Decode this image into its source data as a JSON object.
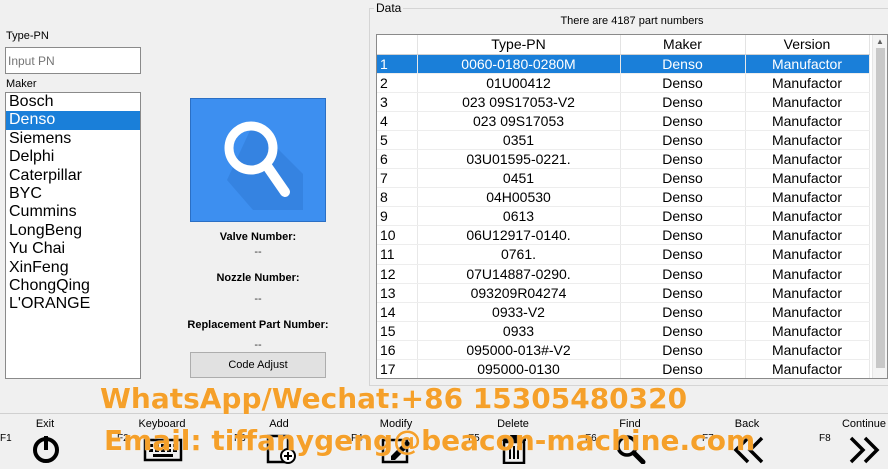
{
  "left": {
    "type_pn_label": "Type-PN",
    "input_placeholder": "Input PN",
    "maker_label": "Maker",
    "makers": [
      "Bosch",
      "Denso",
      "Siemens",
      "Delphi",
      "Caterpillar",
      "BYC",
      "Cummins",
      "LongBeng",
      "Yu Chai",
      "XinFeng",
      "ChongQing",
      "L'ORANGE"
    ],
    "selected_maker": "Denso"
  },
  "info": {
    "valve_label": "Valve Number:",
    "valve_value": "--",
    "nozzle_label": "Nozzle Number:",
    "nozzle_value": "--",
    "replacement_label": "Replacement Part Number:",
    "replacement_value": "--",
    "code_adjust": "Code Adjust"
  },
  "data": {
    "title": "Data",
    "count_text": "There are 4187 part numbers",
    "columns": [
      "",
      "Type-PN",
      "Maker",
      "Version"
    ],
    "rows": [
      [
        "1",
        "0060-0180-0280M",
        "Denso",
        "Manufactor"
      ],
      [
        "2",
        "01U00412",
        "Denso",
        "Manufactor"
      ],
      [
        "3",
        "023 09S17053-V2",
        "Denso",
        "Manufactor"
      ],
      [
        "4",
        "023 09S17053",
        "Denso",
        "Manufactor"
      ],
      [
        "5",
        "0351",
        "Denso",
        "Manufactor"
      ],
      [
        "6",
        "03U01595-0221.",
        "Denso",
        "Manufactor"
      ],
      [
        "7",
        "0451",
        "Denso",
        "Manufactor"
      ],
      [
        "8",
        "04H00530",
        "Denso",
        "Manufactor"
      ],
      [
        "9",
        "0613",
        "Denso",
        "Manufactor"
      ],
      [
        "10",
        "06U12917-0140.",
        "Denso",
        "Manufactor"
      ],
      [
        "11",
        "0761.",
        "Denso",
        "Manufactor"
      ],
      [
        "12",
        "07U14887-0290.",
        "Denso",
        "Manufactor"
      ],
      [
        "13",
        "093209R04274",
        "Denso",
        "Manufactor"
      ],
      [
        "14",
        "0933-V2",
        "Denso",
        "Manufactor"
      ],
      [
        "15",
        "0933",
        "Denso",
        "Manufactor"
      ],
      [
        "16",
        "095000-013#-V2",
        "Denso",
        "Manufactor"
      ],
      [
        "17",
        "095000-0130",
        "Denso",
        "Manufactor"
      ]
    ],
    "selected_row": 0
  },
  "function_keys": [
    {
      "key": "F1",
      "label": "Exit",
      "icon": "power-icon"
    },
    {
      "key": "F2",
      "label": "Keyboard",
      "icon": "keyboard-icon"
    },
    {
      "key": "F3",
      "label": "Add",
      "icon": "add-document-icon"
    },
    {
      "key": "F4",
      "label": "Modify",
      "icon": "edit-icon"
    },
    {
      "key": "F5",
      "label": "Delete",
      "icon": "trash-icon"
    },
    {
      "key": "F6",
      "label": "Find",
      "icon": "search-icon"
    },
    {
      "key": "F7",
      "label": "Back",
      "icon": "double-chevron-left-icon"
    },
    {
      "key": "F8",
      "label": "Continue",
      "icon": "double-chevron-right-icon"
    }
  ],
  "watermark": {
    "line1": "WhatsApp/Wechat:+86 15305480320",
    "line2": "Email:  tiffanygeng@beacon-machine.com"
  },
  "colors": {
    "selection": "#1a7fd9",
    "search_tile": "#3d8ff0",
    "watermark": "#f5a02a"
  }
}
